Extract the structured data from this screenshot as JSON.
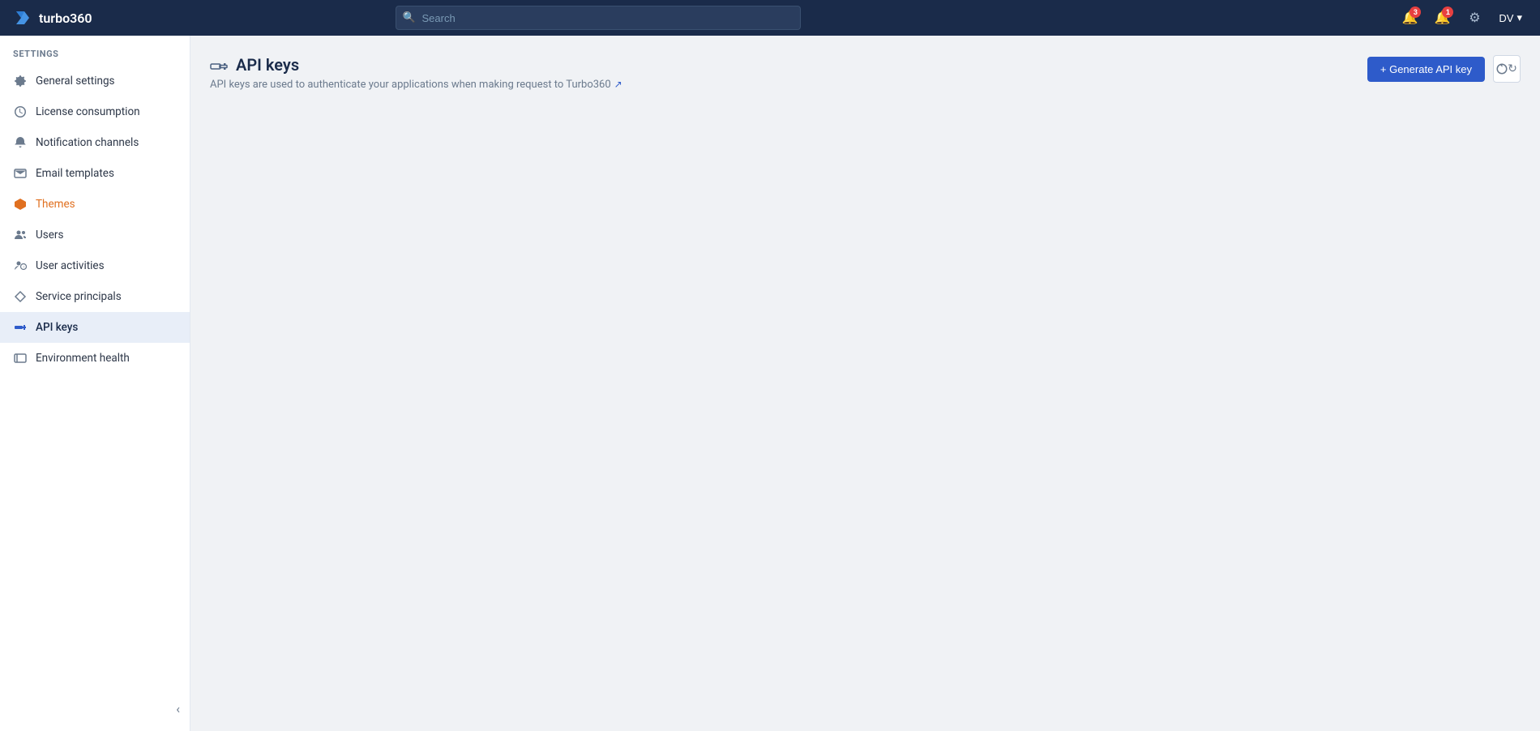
{
  "app": {
    "name": "turbo360"
  },
  "navbar": {
    "brand_label": "turbo360",
    "search_placeholder": "Search",
    "notifications_badge": "3",
    "alerts_badge": "1",
    "user_initials": "DV"
  },
  "sidebar": {
    "section_label": "SETTINGS",
    "items": [
      {
        "id": "general-settings",
        "label": "General settings",
        "icon": "⚙",
        "active": false
      },
      {
        "id": "license-consumption",
        "label": "License consumption",
        "icon": "◑",
        "active": false
      },
      {
        "id": "notification-channels",
        "label": "Notification channels",
        "icon": "🔔",
        "active": false
      },
      {
        "id": "email-templates",
        "label": "Email templates",
        "icon": "✉",
        "active": false
      },
      {
        "id": "themes",
        "label": "Themes",
        "icon": "⬡",
        "active": false,
        "special": "themes"
      },
      {
        "id": "users",
        "label": "Users",
        "icon": "👥",
        "active": false
      },
      {
        "id": "user-activities",
        "label": "User activities",
        "icon": "⏱",
        "active": false
      },
      {
        "id": "service-principals",
        "label": "Service principals",
        "icon": "◇",
        "active": false
      },
      {
        "id": "api-keys",
        "label": "API keys",
        "icon": "▬",
        "active": true
      },
      {
        "id": "environment-health",
        "label": "Environment health",
        "icon": "□",
        "active": false
      }
    ],
    "collapse_label": "‹"
  },
  "main": {
    "page_title": "API keys",
    "page_subtitle": "API keys are used to authenticate your applications when making request to Turbo360",
    "generate_button_label": "+ Generate API key",
    "refresh_button_title": "Refresh"
  }
}
